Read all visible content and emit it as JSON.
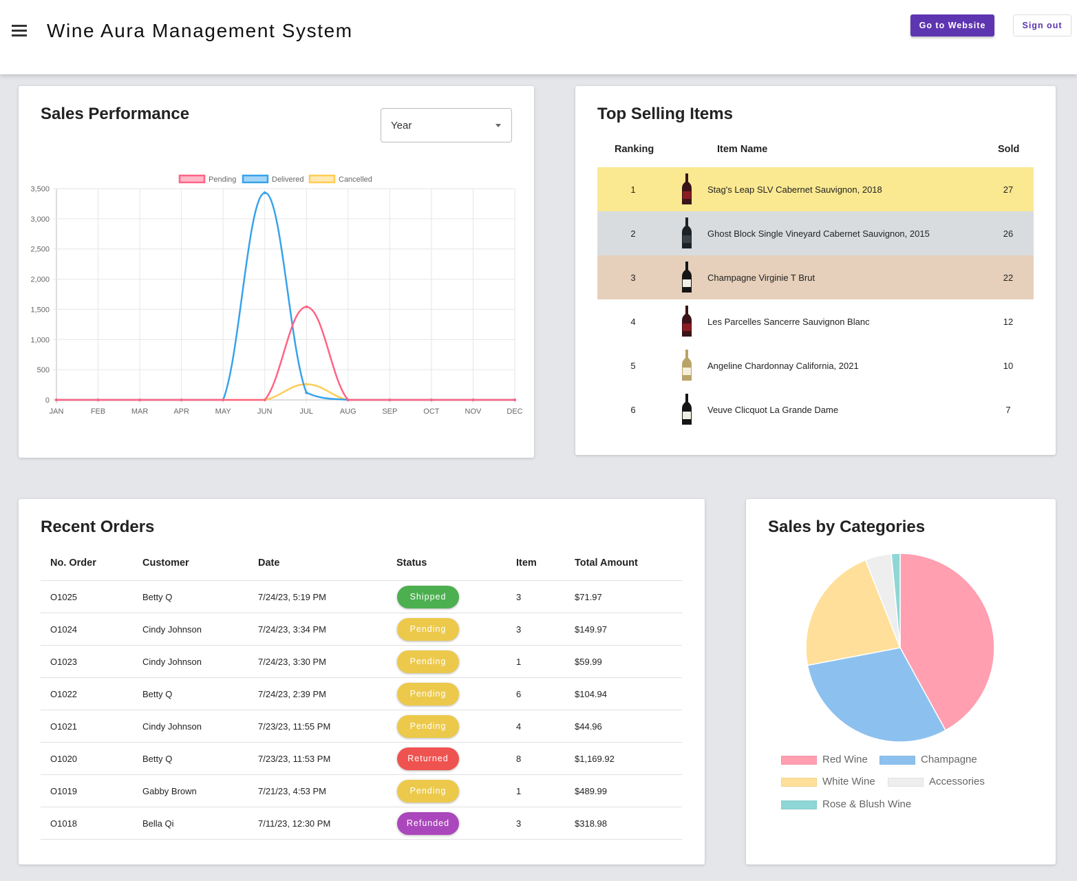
{
  "header": {
    "title": "Wine Aura Management System",
    "website_button": "Go to Website",
    "signout_button": "Sign out"
  },
  "sales_performance": {
    "title": "Sales Performance",
    "period_select": {
      "value": "Year"
    }
  },
  "colors": {
    "pending": "#ff6384",
    "delivered": "#36a2eb",
    "cancelled": "#ffcd56",
    "accent": "#5e35b1",
    "shipped": "#4caf50",
    "pending_badge": "#ecc94b",
    "returned": "#ef5350",
    "refunded": "#ab47bc"
  },
  "chart_data": [
    {
      "type": "line",
      "categories": [
        "JAN",
        "FEB",
        "MAR",
        "APR",
        "MAY",
        "JUN",
        "JUL",
        "AUG",
        "SEP",
        "OCT",
        "NOV",
        "DEC"
      ],
      "series": [
        {
          "name": "Pending",
          "color": "#ff6384",
          "values": [
            0,
            0,
            0,
            0,
            0,
            0,
            1540,
            0,
            0,
            0,
            0,
            0
          ]
        },
        {
          "name": "Delivered",
          "color": "#36a2eb",
          "values": [
            0,
            0,
            0,
            0,
            0,
            3430,
            120,
            0,
            0,
            0,
            0,
            0
          ]
        },
        {
          "name": "Cancelled",
          "color": "#ffcd56",
          "values": [
            0,
            0,
            0,
            0,
            0,
            0,
            260,
            0,
            0,
            0,
            0,
            0
          ]
        }
      ],
      "yticks": [
        "0",
        "500",
        "1,000",
        "1,500",
        "2,000",
        "2,500",
        "3,000",
        "3,500"
      ],
      "ylim": [
        0,
        3500
      ],
      "grid": true,
      "legend": "top"
    },
    {
      "type": "pie",
      "labels": [
        "Red Wine",
        "Champagne",
        "White Wine",
        "Accessories",
        "Rose & Blush Wine"
      ],
      "values": [
        42,
        30,
        22,
        4.5,
        1.5
      ],
      "colors": [
        "#ff9fb0",
        "#8cc1ef",
        "#ffdf99",
        "#eeeeee",
        "#8fd6d6"
      ],
      "legend": "bottom"
    }
  ],
  "top_selling": {
    "title": "Top Selling Items",
    "columns": [
      "Ranking",
      "Item Name",
      "Sold"
    ],
    "rows": [
      {
        "rank": "1",
        "name": "Stag's Leap SLV Cabernet Sauvignon, 2018",
        "sold": "27",
        "bg": "#fbe991",
        "bottle": "red-wine-bottle"
      },
      {
        "rank": "2",
        "name": "Ghost Block Single Vineyard Cabernet Sauvignon, 2015",
        "sold": "26",
        "bg": "#d9dcdf",
        "bottle": "dark-wine-bottle"
      },
      {
        "rank": "3",
        "name": "Champagne Virginie T Brut",
        "sold": "22",
        "bg": "#e6d0bb",
        "bottle": "champagne-bottle"
      },
      {
        "rank": "4",
        "name": "Les Parcelles Sancerre Sauvignon Blanc",
        "sold": "12",
        "bg": "#ffffff",
        "bottle": "red-wine-bottle"
      },
      {
        "rank": "5",
        "name": "Angeline Chardonnay California, 2021",
        "sold": "10",
        "bg": "#ffffff",
        "bottle": "white-wine-bottle"
      },
      {
        "rank": "6",
        "name": "Veuve Clicquot La Grande Dame",
        "sold": "7",
        "bg": "#ffffff",
        "bottle": "champagne-bottle"
      }
    ]
  },
  "recent_orders": {
    "title": "Recent Orders",
    "columns": [
      "No. Order",
      "Customer",
      "Date",
      "Status",
      "Item",
      "Total Amount"
    ],
    "rows": [
      {
        "no": "O1025",
        "customer": "Betty Q",
        "date": "7/24/23, 5:19 PM",
        "status": "Shipped",
        "item": "3",
        "total": "$71.97"
      },
      {
        "no": "O1024",
        "customer": "Cindy Johnson",
        "date": "7/24/23, 3:34 PM",
        "status": "Pending",
        "item": "3",
        "total": "$149.97"
      },
      {
        "no": "O1023",
        "customer": "Cindy Johnson",
        "date": "7/24/23, 3:30 PM",
        "status": "Pending",
        "item": "1",
        "total": "$59.99"
      },
      {
        "no": "O1022",
        "customer": "Betty Q",
        "date": "7/24/23, 2:39 PM",
        "status": "Pending",
        "item": "6",
        "total": "$104.94"
      },
      {
        "no": "O1021",
        "customer": "Cindy Johnson",
        "date": "7/23/23, 11:55 PM",
        "status": "Pending",
        "item": "4",
        "total": "$44.96"
      },
      {
        "no": "O1020",
        "customer": "Betty Q",
        "date": "7/23/23, 11:53 PM",
        "status": "Returned",
        "item": "8",
        "total": "$1,169.92"
      },
      {
        "no": "O1019",
        "customer": "Gabby Brown",
        "date": "7/21/23, 4:53 PM",
        "status": "Pending",
        "item": "1",
        "total": "$489.99"
      },
      {
        "no": "O1018",
        "customer": "Bella Qi",
        "date": "7/11/23, 12:30 PM",
        "status": "Refunded",
        "item": "3",
        "total": "$318.98"
      }
    ]
  },
  "sales_by_categories": {
    "title": "Sales by Categories"
  }
}
